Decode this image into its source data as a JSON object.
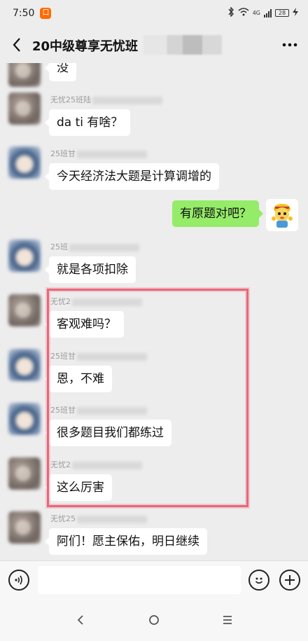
{
  "status": {
    "time": "7:50",
    "app_badge": "口",
    "network": "4G",
    "battery": "28"
  },
  "header": {
    "title": "20中级尊享无忧班"
  },
  "messages": [
    {
      "sender_prefix": "",
      "text": "没"
    },
    {
      "sender_prefix": "无忧25班陆",
      "text": "da ti 有啥？"
    },
    {
      "sender_prefix": "25班甘",
      "text": "今天经济法大题是计算调增的"
    },
    {
      "sender_prefix": "",
      "text": "有原题对吧？"
    },
    {
      "sender_prefix": "25班",
      "text": "就是各项扣除"
    },
    {
      "sender_prefix": "无忧2",
      "text": "客观难吗？"
    },
    {
      "sender_prefix": "25班甘",
      "text": "恩，不难"
    },
    {
      "sender_prefix": "25班甘",
      "text": "很多题目我们都练过"
    },
    {
      "sender_prefix": "无忧2",
      "text": "这么厉害"
    },
    {
      "sender_prefix": "无忧25",
      "text": "阿们！愿主保佑，明日继续"
    }
  ],
  "colors": {
    "my_bubble": "#95ec69",
    "highlight": "#e8677a",
    "background": "#ededed"
  },
  "icons": {
    "back": "chevron-left-icon",
    "more": "more-dots-icon",
    "voice": "voice-icon",
    "emoji": "emoji-icon",
    "plus": "plus-icon"
  }
}
